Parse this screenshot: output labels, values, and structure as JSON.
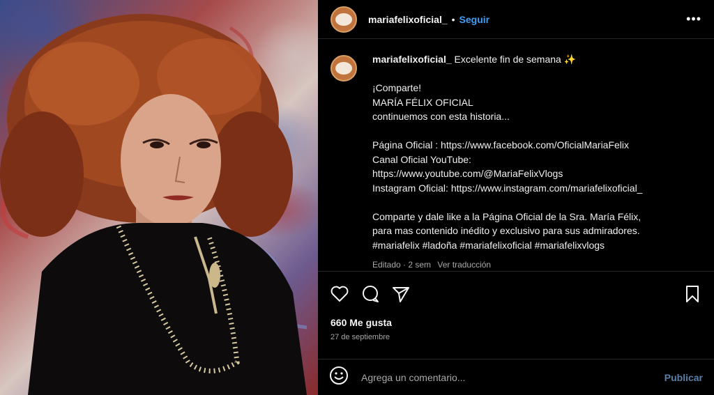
{
  "post": {
    "photo_alt": "Portrait photo",
    "header": {
      "username": "mariafelixoficial_",
      "separator": "•",
      "follow_label": "Seguir",
      "more_label": "•••"
    },
    "caption": {
      "username": "mariafelixoficial_",
      "first_line": "Excelente fin de semana ✨",
      "lines_block1": [
        "¡Comparte!",
        "MARÍA FÉLIX OFICIAL",
        "continuemos con esta historia..."
      ],
      "lines_block2": [
        "Página Oficial : https://www.facebook.com/OficialMariaFelix",
        "Canal Oficial YouTube:",
        "https://www.youtube.com/@MariaFelixVlogs",
        "Instagram Oficial: https://www.instagram.com/mariafelixoficial_"
      ],
      "lines_block3": [
        "Comparte y dale like a la Página Oficial de la Sra. María Félix,",
        "para mas contenido inédito y exclusivo para sus admiradores.",
        "#mariafelix #ladoña #mariafelixoficial #mariafelixvlogs"
      ],
      "edited_label": "Editado · 2 sem",
      "translate_label": "Ver traducción"
    },
    "likes": "660 Me gusta",
    "date": "27 de septiembre",
    "comment": {
      "placeholder": "Agrega un comentario...",
      "publish_label": "Publicar"
    },
    "icons": {
      "like": "heart-icon",
      "comment": "comment-icon",
      "share": "share-icon",
      "save": "bookmark-icon",
      "emoji": "emoji-icon"
    }
  }
}
